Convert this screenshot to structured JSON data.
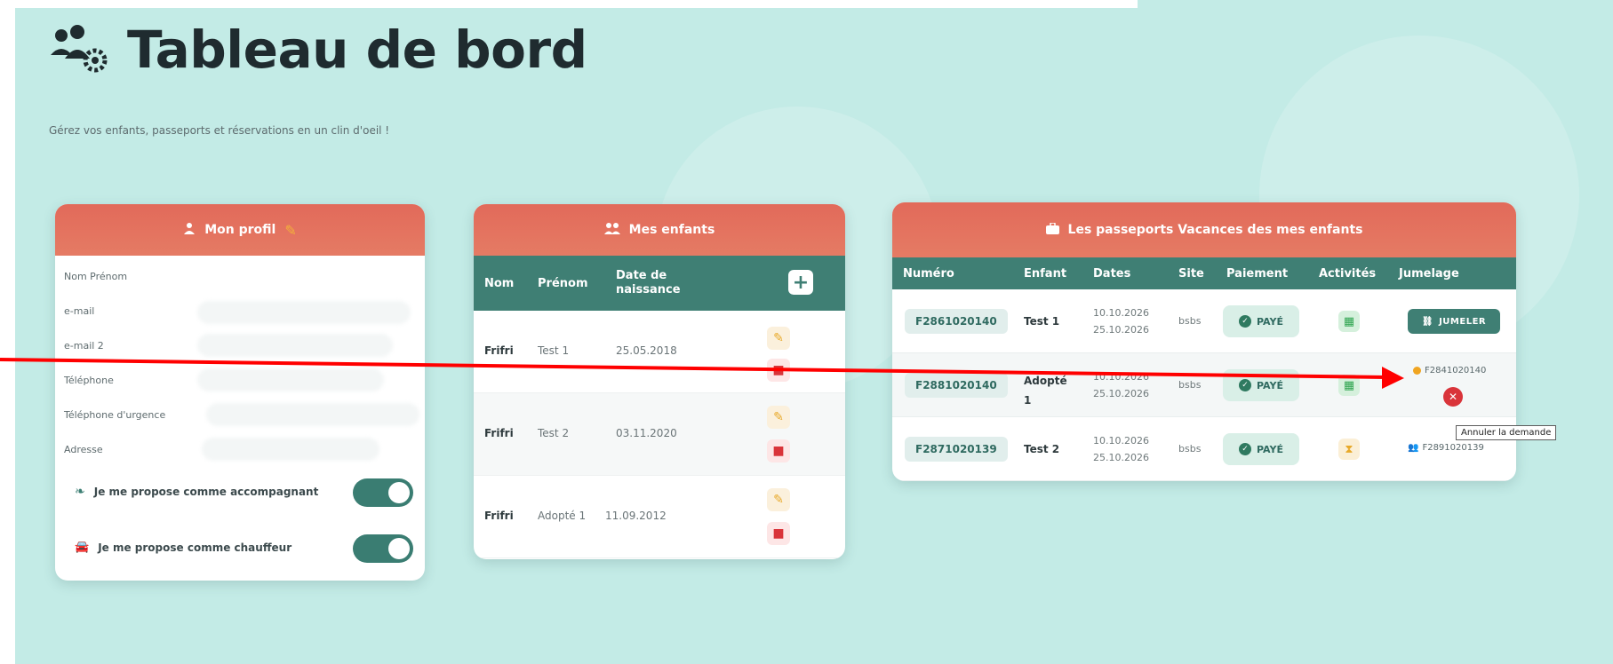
{
  "page": {
    "title": "Tableau de bord",
    "subtitle": "Gérez vos enfants, passeports et réservations en un clin d'oeil !"
  },
  "profile": {
    "header": "Mon profil",
    "edit_icon": "pencil-icon",
    "fields": [
      {
        "label": "Nom Prénom"
      },
      {
        "label": "e-mail"
      },
      {
        "label": "e-mail 2"
      },
      {
        "label": "Téléphone"
      },
      {
        "label": "Téléphone d'urgence"
      },
      {
        "label": "Adresse"
      }
    ],
    "toggles": [
      {
        "label": "Je me propose comme accompagnant",
        "icon": "leaf-icon",
        "on": true
      },
      {
        "label": "Je me propose comme chauffeur",
        "icon": "car-icon",
        "on": true
      }
    ]
  },
  "children": {
    "header": "Mes enfants",
    "columns": [
      "Nom",
      "Prénom",
      "Date de naissance"
    ],
    "add_label": "+",
    "rows": [
      {
        "nom": "Frifri",
        "prenom": "Test 1",
        "naissance": "25.05.2018"
      },
      {
        "nom": "Frifri",
        "prenom": "Test 2",
        "naissance": "03.11.2020"
      },
      {
        "nom": "Frifri",
        "prenom": "Adopté 1",
        "naissance": "11.09.2012"
      }
    ]
  },
  "passports": {
    "header": "Les passeports Vacances des mes enfants",
    "columns": [
      "Numéro",
      "Enfant",
      "Dates",
      "Site",
      "Paiement",
      "Activités",
      "Jumelage"
    ],
    "rows": [
      {
        "numero": "F28610201​40",
        "enfant": "Test 1",
        "date_start": "10.10.2026",
        "date_end": "25.10.2026",
        "site": "bsbs",
        "paiement": "PAYÉ",
        "activite": "green",
        "jumelage_button": "JUMELER"
      },
      {
        "numero": "F28810201​40",
        "enfant": "Adopté 1",
        "date_start": "10.10.2026",
        "date_end": "25.10.2026",
        "site": "bsbs",
        "paiement": "PAYÉ",
        "activite": "green",
        "jumelage_text": "F28410201​40"
      },
      {
        "numero": "F2871020139",
        "enfant": "Test 2",
        "date_start": "10.10.2026",
        "date_end": "25.10.2026",
        "site": "bsbs",
        "paiement": "PAYÉ",
        "activite": "orange",
        "jumelage_text": "F2891020139"
      }
    ],
    "tooltip": "Annuler la demande"
  },
  "colors": {
    "accent_coral": "#e26a5a",
    "table_header_teal": "#3f7f74",
    "background_mint": "#c3ebe6",
    "arrow_red": "#ff0000"
  }
}
